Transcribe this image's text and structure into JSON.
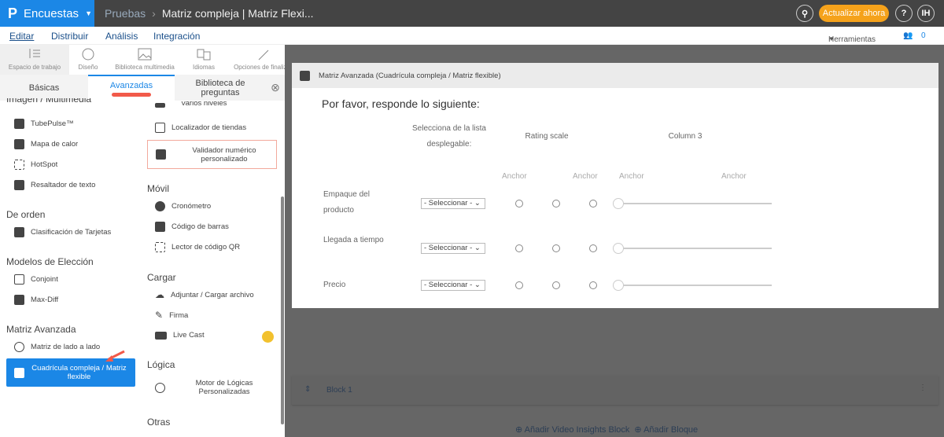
{
  "topbar": {
    "brand": "Encuestas",
    "crumb_parent": "Pruebas",
    "crumb_current": "Matriz compleja | Matriz Flexi...",
    "upgrade": "Actualizar ahora",
    "help": "?",
    "avatar": "IH"
  },
  "nav": {
    "items": [
      "Editar",
      "Distribuir",
      "Análisis",
      "Integración"
    ],
    "tools": "Herramientas",
    "collab_count": "0"
  },
  "toolbar": [
    "Espacio de trabajo",
    "Diseño",
    "Biblioteca multimedia",
    "Idiomas",
    "Opciones de finalizaci"
  ],
  "panel": {
    "tabs": [
      "Básicas",
      "Avanzadas",
      "Biblioteca de preguntas"
    ],
    "col1": {
      "s_img": "Imagen / Multimedia",
      "tubepulse": "TubePulse™",
      "heatmap": "Mapa de calor",
      "hotspot": "HotSpot",
      "highlighter": "Resaltador de texto",
      "s_order": "De orden",
      "cardsort": "Clasificación de Tarjetas",
      "s_choice": "Modelos de Elección",
      "conjoint": "Conjoint",
      "maxdiff": "Max-Diff",
      "s_matrix": "Matriz Avanzada",
      "sidebyside": "Matriz de lado a lado",
      "complex": "Cuadrícula compleja / Matriz flexible"
    },
    "col2": {
      "multilevel": "Varios niveles",
      "store": "Localizador de tiendas",
      "validator": "Validador numérico personalizado",
      "s_mobile": "Móvil",
      "timer": "Cronómetro",
      "barcode": "Código de barras",
      "qr": "Lector de código QR",
      "s_upload": "Cargar",
      "upload": "Adjuntar / Cargar archivo",
      "sign": "Firma",
      "livecast": "Live Cast",
      "s_logic": "Lógica",
      "logic": "Motor de Lógicas Personalizadas",
      "s_other": "Otras"
    }
  },
  "modal": {
    "title": "Matriz Avanzada (Cuadrícula compleja / Matriz flexible)",
    "question": "Por favor, responde lo siguiente:",
    "col_headers": [
      "Selecciona de la lista desplegable:",
      "Rating scale",
      "Column 3"
    ],
    "anchor": "Anchor",
    "rows": [
      "Empaque del producto",
      "Llegada a tiempo",
      "Precio"
    ],
    "select": "- Seleccionar -",
    "slider_value": 0
  },
  "block": {
    "name": "Block 1",
    "add_video": "Añadir Video Insights Block",
    "add_block": "Añadir Bloque"
  },
  "colors": {
    "brand": "#1b87e6",
    "accent": "#f5a21b"
  }
}
